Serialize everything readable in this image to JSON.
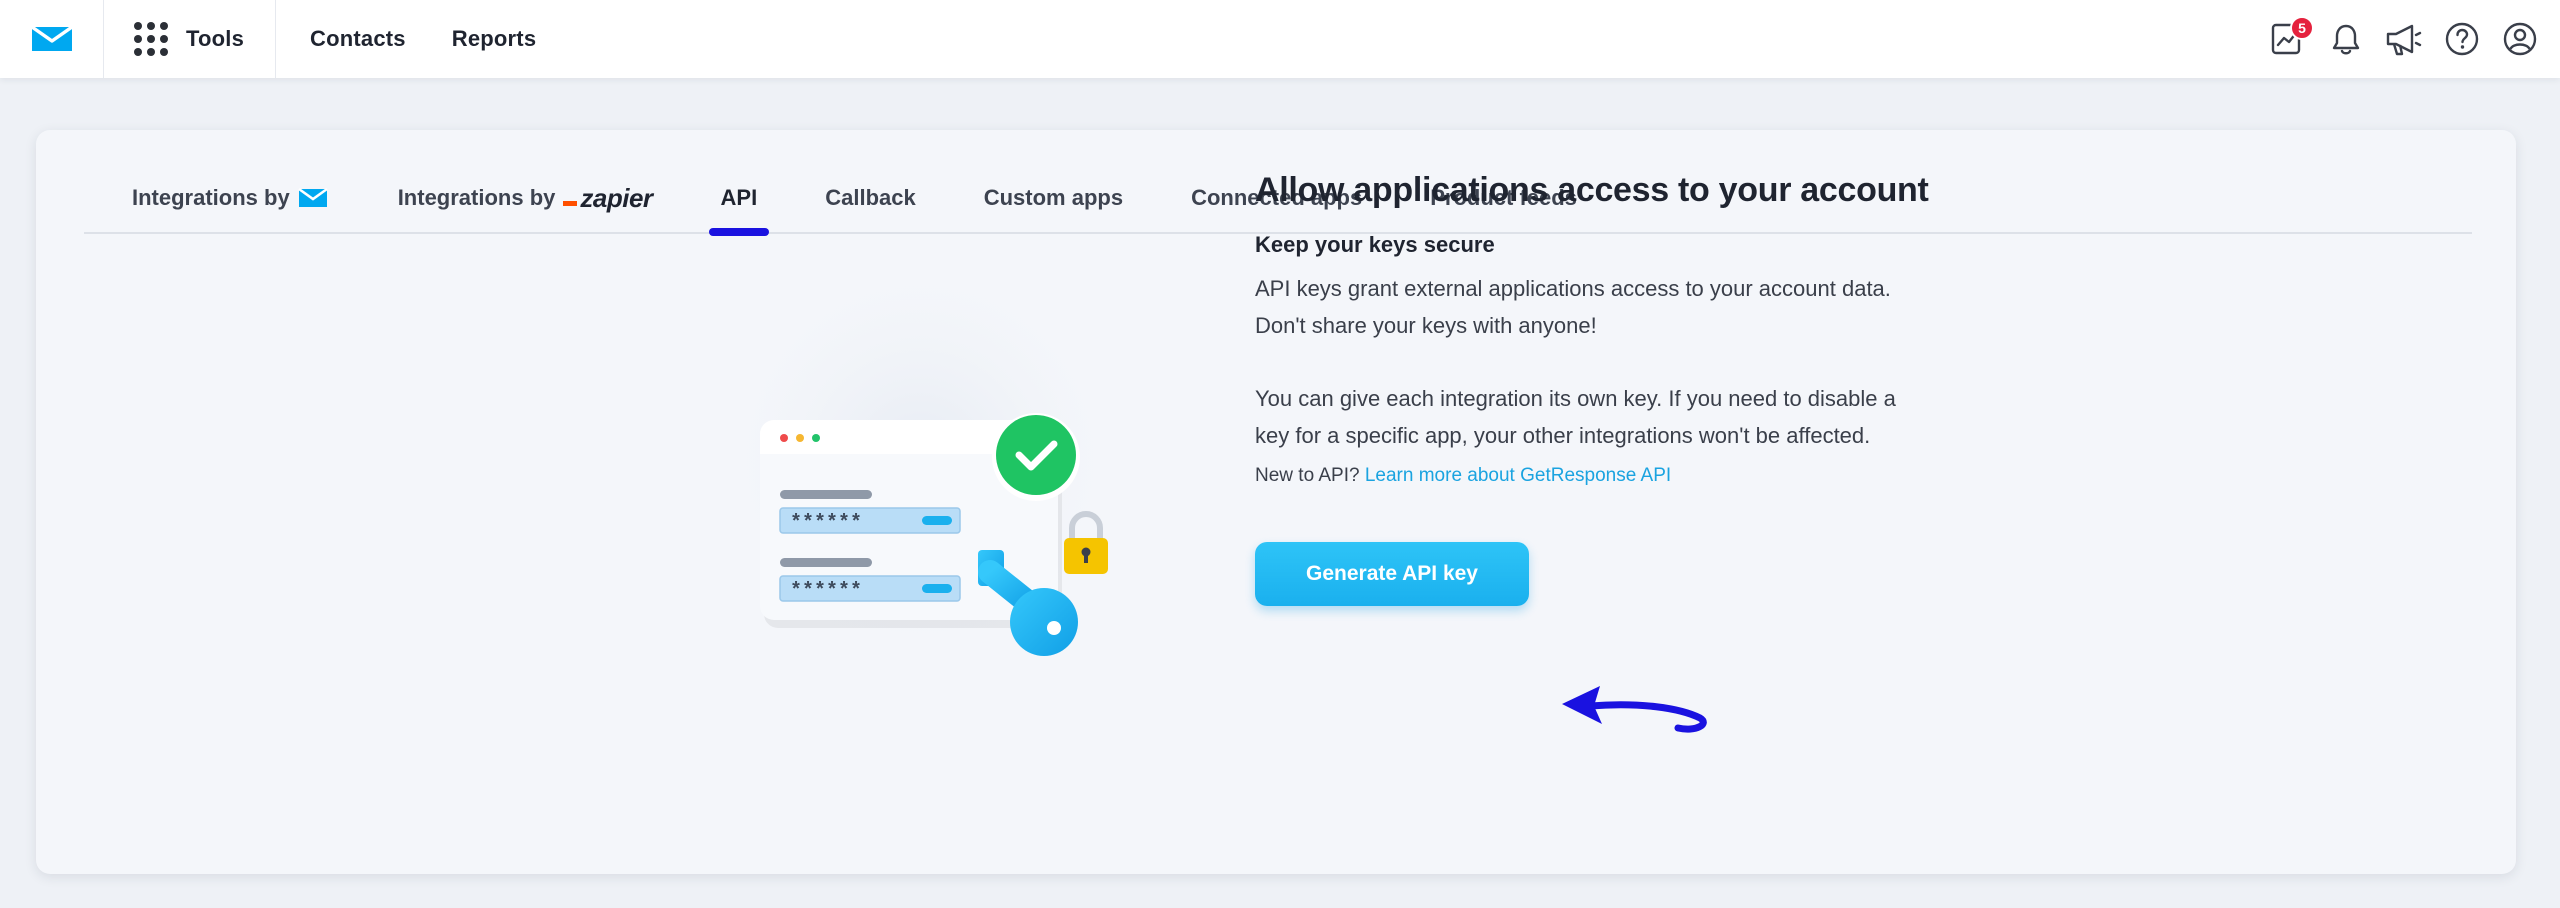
{
  "topbar": {
    "tools_label": "Tools",
    "nav": [
      {
        "label": "Contacts"
      },
      {
        "label": "Reports"
      }
    ],
    "notification_count": "5"
  },
  "tabs": [
    {
      "label": "Integrations by",
      "suffix": "getresponse-logo",
      "active": false
    },
    {
      "label": "Integrations by",
      "suffix": "zapier-logo",
      "suffix_text": "zapier",
      "active": false
    },
    {
      "label": "API",
      "active": true
    },
    {
      "label": "Callback",
      "active": false
    },
    {
      "label": "Custom apps",
      "active": false
    },
    {
      "label": "Connected apps",
      "active": false
    },
    {
      "label": "Product feeds",
      "active": false
    }
  ],
  "illustration": {
    "masked_key_1": "******",
    "masked_key_2": "******"
  },
  "content": {
    "title": "Allow applications access to your account",
    "subtitle": "Keep your keys secure",
    "paragraph1_line1": "API keys grant external applications access to your account data.",
    "paragraph1_line2": "Don't share your keys with anyone!",
    "paragraph2_line1": "You can give each integration its own key. If you need to disable a",
    "paragraph2_line2": "key for a specific app, your other integrations won't be affected.",
    "help_prefix": "New to API?",
    "help_link": "Learn more about GetResponse API",
    "button_label": "Generate API key"
  },
  "colors": {
    "brand_blue": "#00baff",
    "active_tab_underline": "#1a12e0",
    "button": "#1ab0ee",
    "link": "#1aa3e0",
    "badge": "#e5223e",
    "success_green": "#1fc463",
    "lock_yellow": "#f5c400"
  }
}
